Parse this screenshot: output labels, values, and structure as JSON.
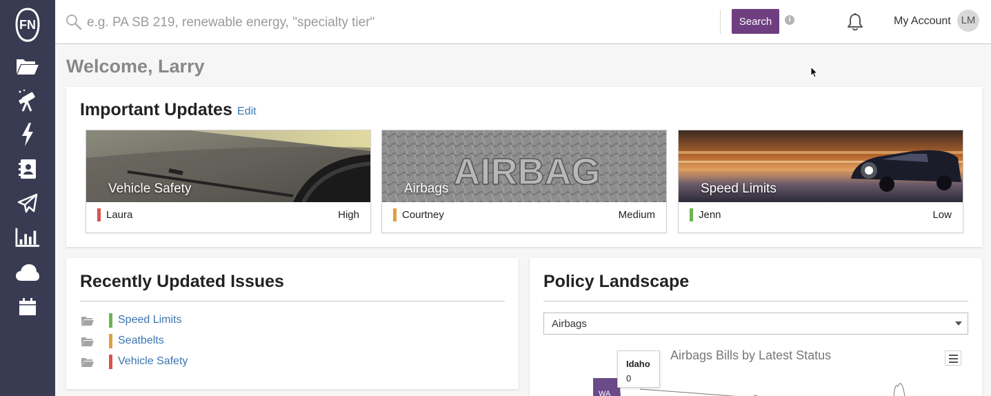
{
  "sidebar": {
    "logo_text": "FN",
    "items": [
      {
        "icon": "folder-open-icon"
      },
      {
        "icon": "telescope-icon"
      },
      {
        "icon": "lightning-icon"
      },
      {
        "icon": "contacts-book-icon"
      },
      {
        "icon": "paper-plane-icon"
      },
      {
        "icon": "bar-chart-icon"
      },
      {
        "icon": "cloud-icon"
      },
      {
        "icon": "calendar-icon"
      }
    ]
  },
  "topbar": {
    "search_placeholder": "e.g. PA SB 219, renewable energy, \"specialty tier\"",
    "search_button": "Search",
    "info": "i",
    "account_label": "My Account",
    "avatar_initials": "LM"
  },
  "welcome": "Welcome, Larry",
  "updates": {
    "title": "Important Updates",
    "edit_label": "Edit",
    "tiles": [
      {
        "title": "Vehicle Safety",
        "owner": "Laura",
        "priority": "High",
        "color": "#d9534f"
      },
      {
        "title": "Airbags",
        "owner": "Courtney",
        "priority": "Medium",
        "color": "#e0a040",
        "image_text": "AIRBAG"
      },
      {
        "title": "Speed Limits",
        "owner": "Jenn",
        "priority": "Low",
        "color": "#6cb451"
      }
    ]
  },
  "issues": {
    "title": "Recently Updated Issues",
    "items": [
      {
        "label": "Speed Limits",
        "color": "#6cb451"
      },
      {
        "label": "Seatbelts",
        "color": "#e0a040"
      },
      {
        "label": "Vehicle Safety",
        "color": "#d9534f"
      }
    ]
  },
  "policy": {
    "title": "Policy Landscape",
    "selected": "Airbags",
    "map_title": "Airbags Bills by Latest Status",
    "tooltip": {
      "state": "Idaho",
      "value": "0"
    },
    "state_label": "WA"
  },
  "colors": {
    "sidebar": "#383b52",
    "accent": "#6e3e80",
    "link": "#3a74b0"
  }
}
